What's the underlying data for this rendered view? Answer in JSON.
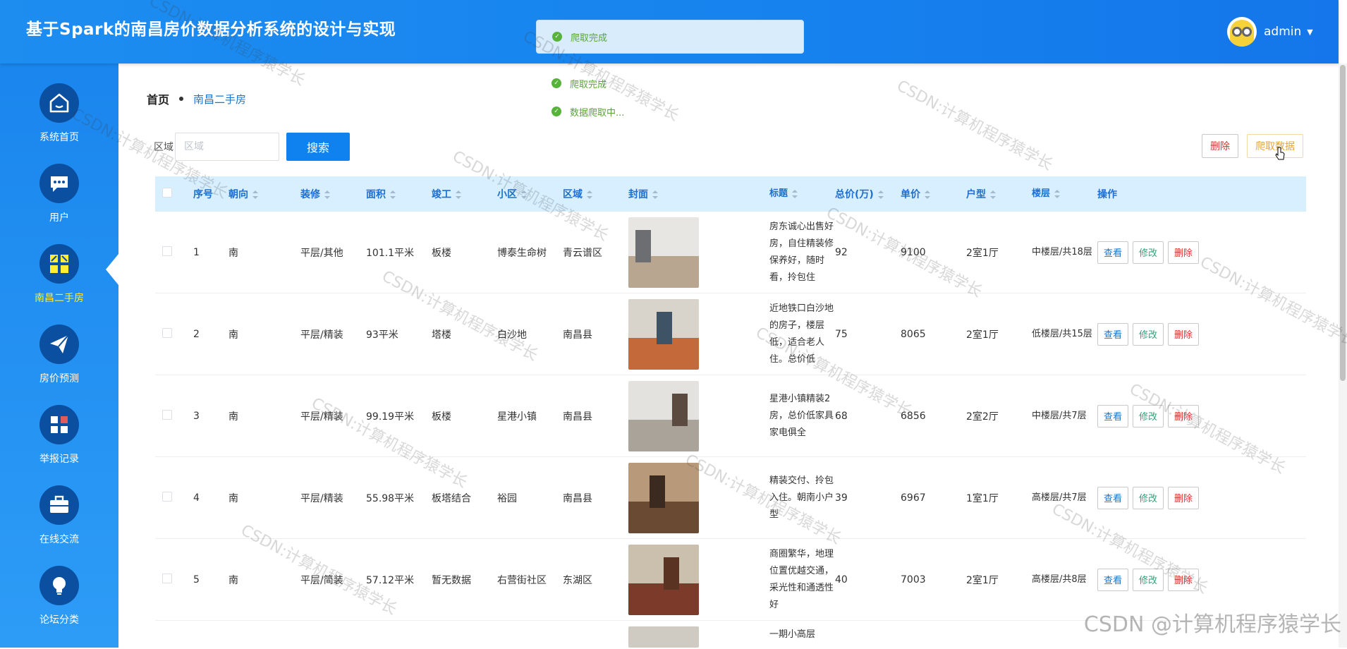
{
  "app": {
    "title": "基于Spark的南昌房价数据分析系统的设计与实现"
  },
  "user": {
    "name": "admin"
  },
  "sidebar": {
    "items": [
      {
        "label": "系统首页",
        "icon": "home-icon"
      },
      {
        "label": "用户",
        "icon": "chat-icon"
      },
      {
        "label": "南昌二手房",
        "icon": "grid-icon",
        "active": true
      },
      {
        "label": "房价预测",
        "icon": "send-icon"
      },
      {
        "label": "举报记录",
        "icon": "apps-icon"
      },
      {
        "label": "在线交流",
        "icon": "briefcase-icon"
      },
      {
        "label": "论坛分类",
        "icon": "bulb-icon"
      }
    ]
  },
  "breadcrumb": {
    "home": "首页",
    "current": "南昌二手房"
  },
  "search": {
    "label": "区域",
    "placeholder": "区域",
    "button": "搜索"
  },
  "actions": {
    "delete": "删除",
    "crawl": "爬取数据"
  },
  "table": {
    "headers": [
      "序号",
      "朝向",
      "装修",
      "面积",
      "竣工",
      "小区",
      "区域",
      "封面",
      "标题",
      "总价(万)",
      "单价",
      "户型",
      "楼层",
      "操作"
    ],
    "rows": [
      {
        "idx": "1",
        "orientation": "南",
        "decoration": "平层/其他",
        "area": "101.1平米",
        "built": "板楼",
        "community": "博泰生命树",
        "region": "青云谱区",
        "title": "房东诚心出售好房，自住精装修保养好，随时看，拎包住",
        "total": "92",
        "unit": "9100",
        "layout": "2室1厅",
        "floor": "中楼层/共18层"
      },
      {
        "idx": "2",
        "orientation": "南",
        "decoration": "平层/精装",
        "area": "93平米",
        "built": "塔楼",
        "community": "白沙地",
        "region": "南昌县",
        "title": "近地铁口白沙地的房子，楼层低，适合老人住。总价低",
        "total": "75",
        "unit": "8065",
        "layout": "2室1厅",
        "floor": "低楼层/共15层"
      },
      {
        "idx": "3",
        "orientation": "南",
        "decoration": "平层/精装",
        "area": "99.19平米",
        "built": "板楼",
        "community": "星港小镇",
        "region": "南昌县",
        "title": "星港小镇精装2房，总价低家具家电俱全",
        "total": "68",
        "unit": "6856",
        "layout": "2室2厅",
        "floor": "中楼层/共7层"
      },
      {
        "idx": "4",
        "orientation": "南",
        "decoration": "平层/精装",
        "area": "55.98平米",
        "built": "板塔结合",
        "community": "裕园",
        "region": "南昌县",
        "title": "精装交付、拎包入住。朝南小户型",
        "total": "39",
        "unit": "6967",
        "layout": "1室1厅",
        "floor": "高楼层/共7层"
      },
      {
        "idx": "5",
        "orientation": "南",
        "decoration": "平层/简装",
        "area": "57.12平米",
        "built": "暂无数据",
        "community": "右营街社区",
        "region": "东湖区",
        "title": "商圈繁华，地理位置优越交通，采光性和通透性好",
        "total": "40",
        "unit": "7003",
        "layout": "2室1厅",
        "floor": "高楼层/共8层"
      },
      {
        "idx": "",
        "orientation": "",
        "decoration": "",
        "area": "",
        "built": "",
        "community": "",
        "region": "",
        "title": "一期小高层",
        "total": "",
        "unit": "",
        "layout": "",
        "floor": ""
      }
    ],
    "ops": {
      "view": "查看",
      "edit": "修改",
      "delete": "删除"
    }
  },
  "notifications": [
    {
      "text": "爬取完成"
    },
    {
      "text": "爬取完成"
    },
    {
      "text": "数据爬取中..."
    }
  ],
  "watermark": {
    "text": "CSDN:计算机程序猿学长",
    "footer": "CSDN @计算机程序猿学长"
  },
  "colors": {
    "header": "#1682ee",
    "sidebar": "#1a86ee",
    "active_label": "#ffee33",
    "primary_button": "#1082f0",
    "success": "#57b33a",
    "table_header": "#d7efff"
  }
}
